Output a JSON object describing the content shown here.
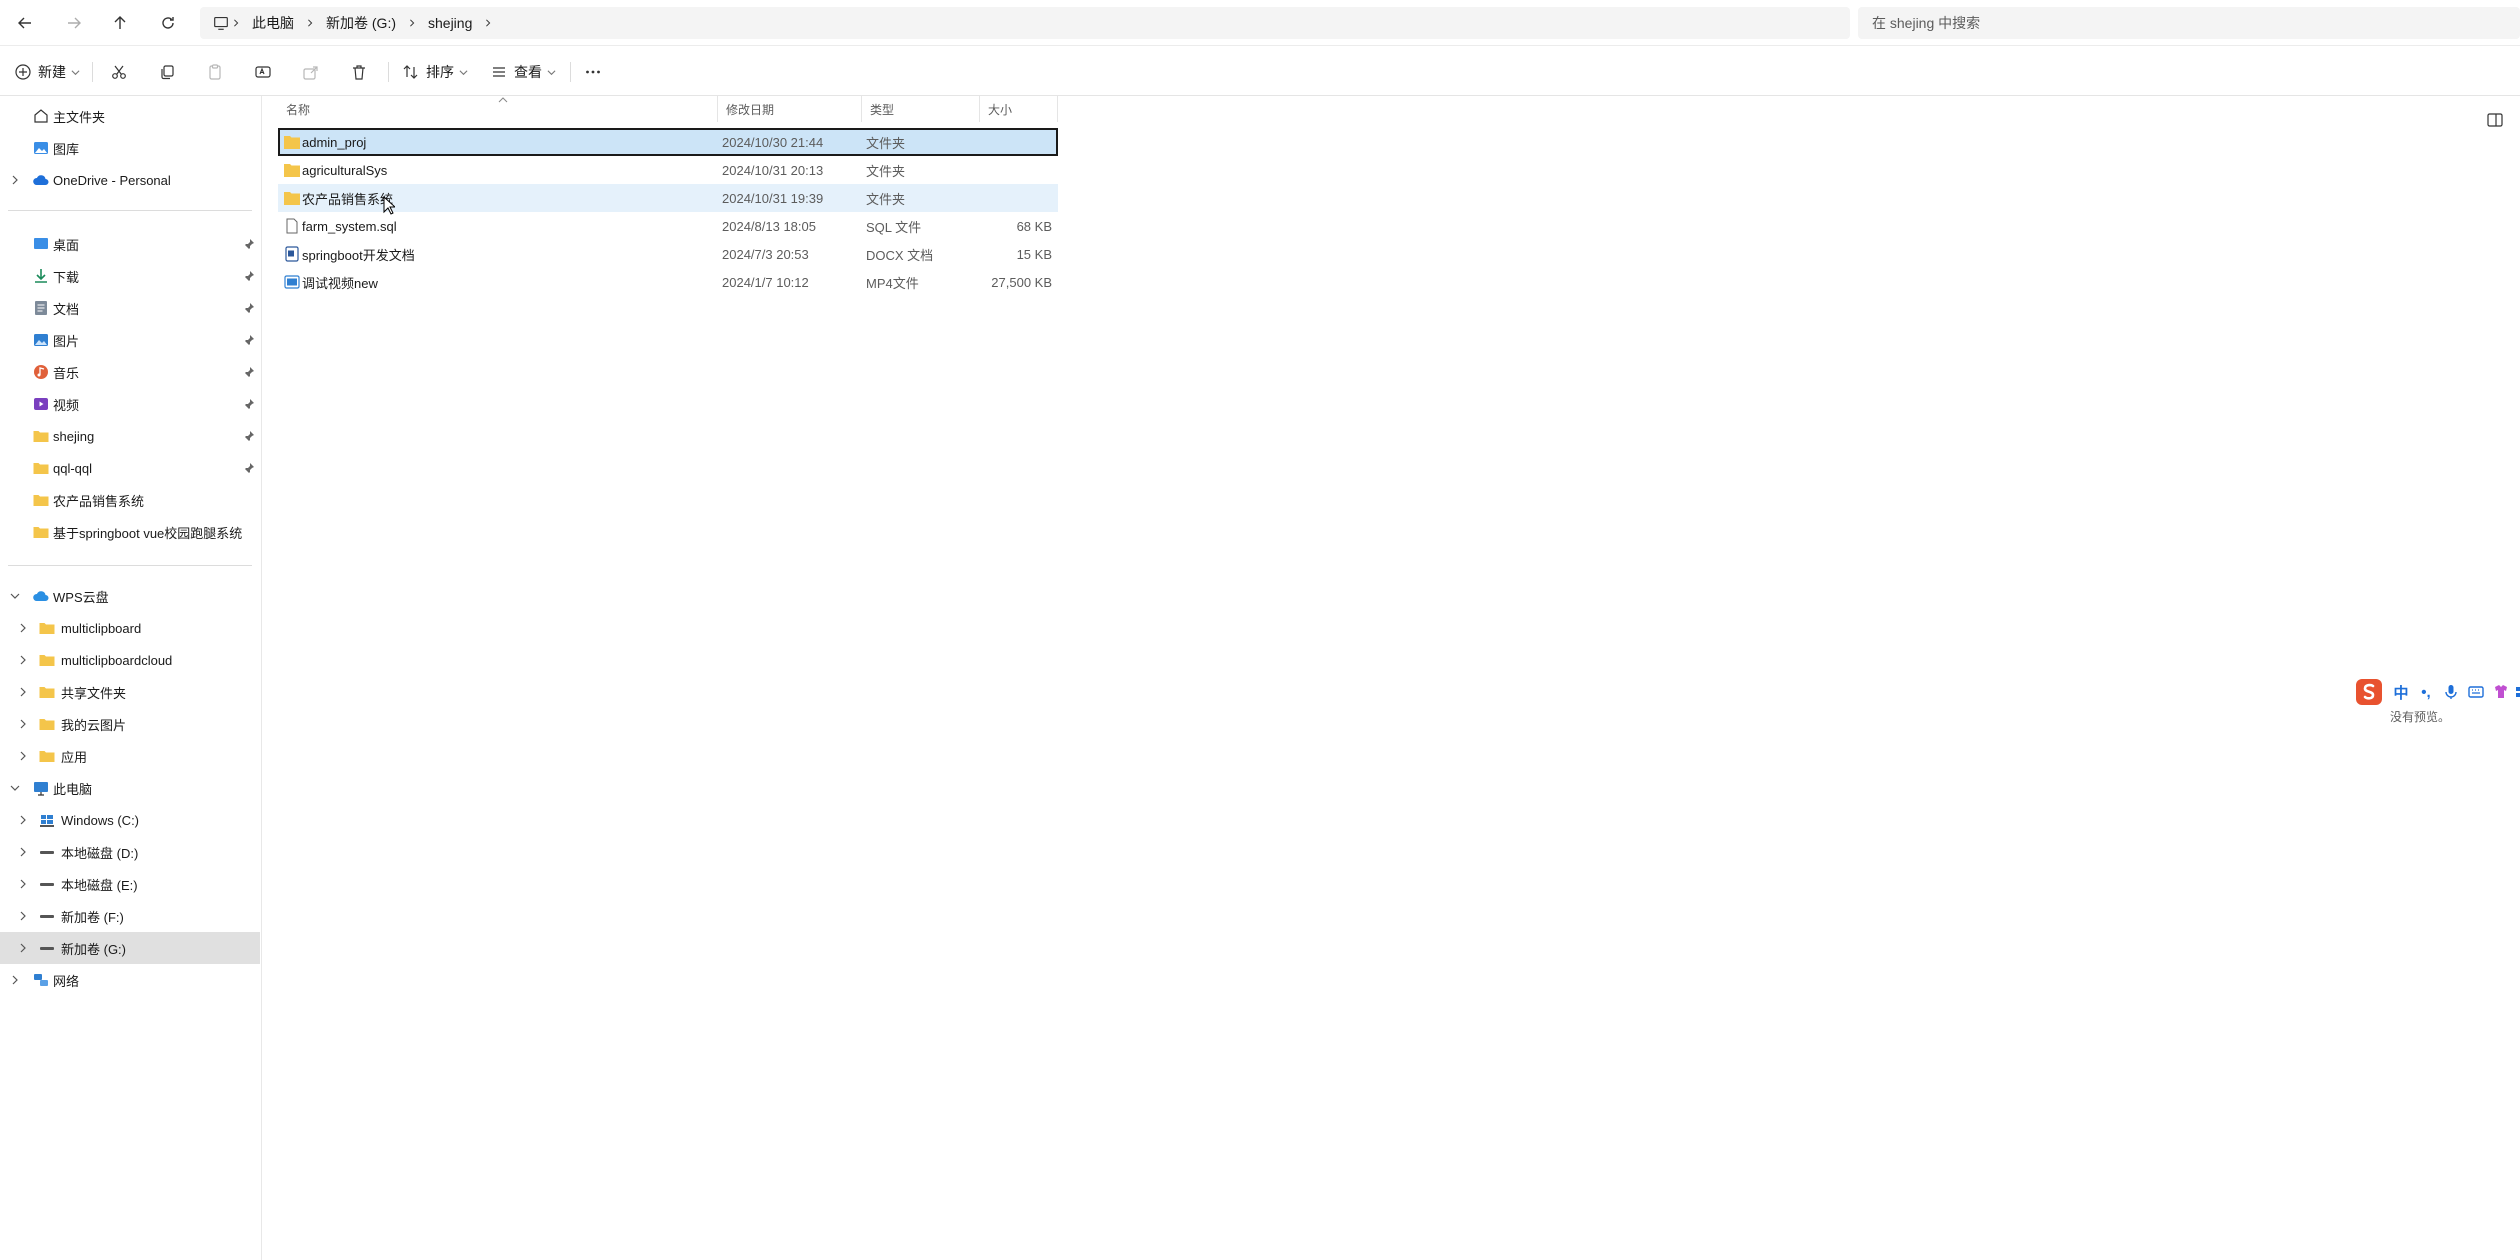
{
  "address_bar": {
    "crumbs": [
      "此电脑",
      "新加卷 (G:)",
      "shejing"
    ]
  },
  "search": {
    "placeholder": "在 shejing 中搜索"
  },
  "toolbar": {
    "new_label": "新建",
    "sort_label": "排序",
    "view_label": "查看"
  },
  "sidebar": {
    "home": "主文件夹",
    "gallery": "图库",
    "onedrive": "OneDrive - Personal",
    "quick_access": [
      {
        "label": "桌面",
        "icon": "desktop-icon",
        "pinned": true
      },
      {
        "label": "下载",
        "icon": "download-icon",
        "pinned": true
      },
      {
        "label": "文档",
        "icon": "document-icon",
        "pinned": true
      },
      {
        "label": "图片",
        "icon": "pictures-icon",
        "pinned": true
      },
      {
        "label": "音乐",
        "icon": "music-icon",
        "pinned": true
      },
      {
        "label": "视频",
        "icon": "video-icon",
        "pinned": true
      },
      {
        "label": "shejing",
        "icon": "folder-icon",
        "pinned": true
      },
      {
        "label": "qql-qql",
        "icon": "folder-icon",
        "pinned": true
      },
      {
        "label": "农产品销售系统",
        "icon": "folder-icon",
        "pinned": false
      },
      {
        "label": "基于springboot vue校园跑腿系统",
        "icon": "folder-icon",
        "pinned": false
      }
    ],
    "wps": {
      "label": "WPS云盘",
      "children": [
        "multiclipboard",
        "multiclipboardcloud",
        "共享文件夹",
        "我的云图片",
        "应用"
      ]
    },
    "this_pc": {
      "label": "此电脑",
      "drives": [
        "Windows (C:)",
        "本地磁盘 (D:)",
        "本地磁盘 (E:)",
        "新加卷 (F:)",
        "新加卷 (G:)"
      ],
      "selected_drive": "新加卷 (G:)"
    },
    "network": "网络"
  },
  "file_list": {
    "columns": {
      "name": "名称",
      "date": "修改日期",
      "type": "类型",
      "size": "大小"
    },
    "rows": [
      {
        "name": "admin_proj",
        "date": "2024/10/30 21:44",
        "type": "文件夹",
        "size": "",
        "icon": "folder-icon",
        "state": "selected"
      },
      {
        "name": "agriculturalSys",
        "date": "2024/10/31 20:13",
        "type": "文件夹",
        "size": "",
        "icon": "folder-icon",
        "state": ""
      },
      {
        "name": "农产品销售系统",
        "date": "2024/10/31 19:39",
        "type": "文件夹",
        "size": "",
        "icon": "folder-icon",
        "state": "hover"
      },
      {
        "name": "farm_system.sql",
        "date": "2024/8/13 18:05",
        "type": "SQL 文件",
        "size": "68 KB",
        "icon": "file-icon",
        "state": ""
      },
      {
        "name": "springboot开发文档",
        "date": "2024/7/3 20:53",
        "type": "DOCX 文档",
        "size": "15 KB",
        "icon": "docx-icon",
        "state": ""
      },
      {
        "name": "调试视频new",
        "date": "2024/1/7 10:12",
        "type": "MP4文件",
        "size": "27,500 KB",
        "icon": "video-file-icon",
        "state": ""
      }
    ]
  },
  "ime": {
    "buttons": [
      "中",
      "•,"
    ],
    "status": "没有预览。"
  },
  "colors": {
    "selection": "#cce4f7",
    "hover": "#e5f1fb",
    "folder": "#f4c54a",
    "sidebar_selected": "#e0e0e0"
  }
}
